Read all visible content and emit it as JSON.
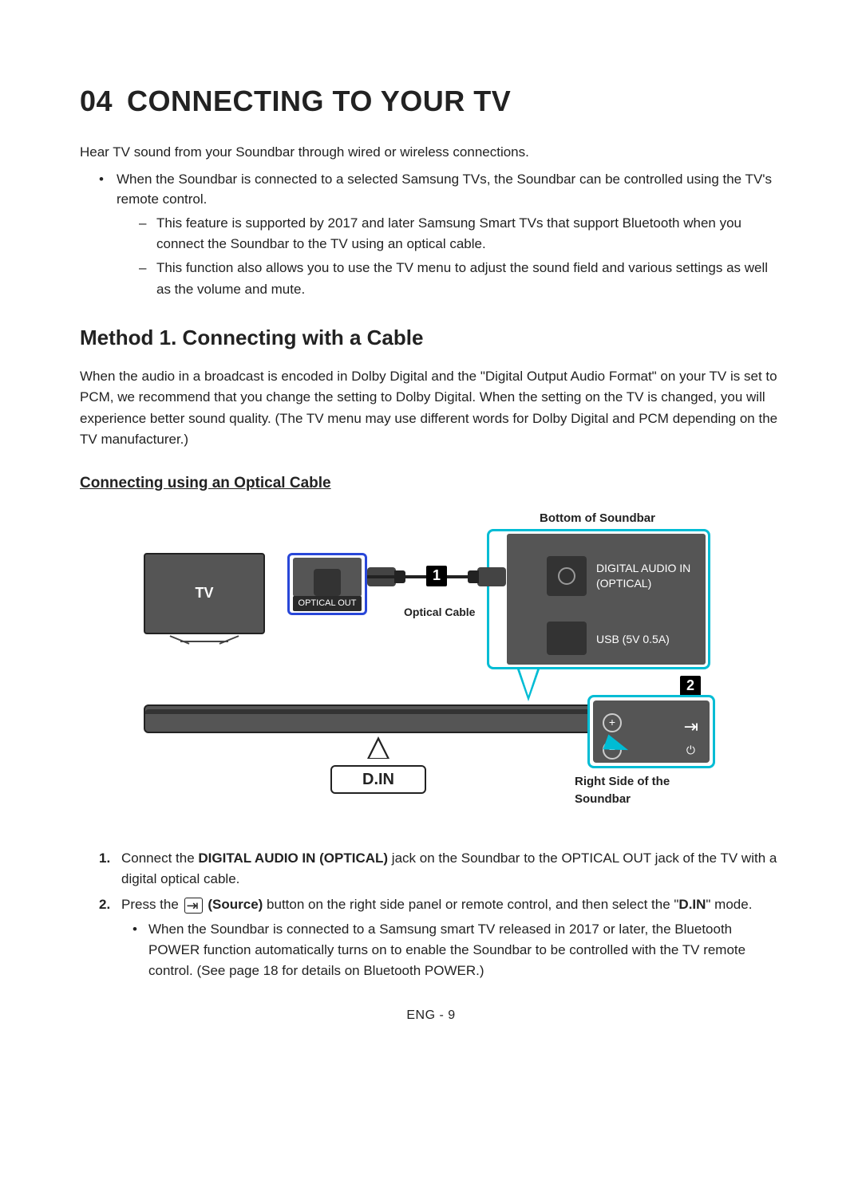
{
  "chapter": {
    "number": "04",
    "title": "CONNECTING TO YOUR TV"
  },
  "intro": "Hear TV sound from your Soundbar through wired or wireless connections.",
  "bullets": {
    "b1": "When the Soundbar is connected to a selected Samsung TVs, the Soundbar can be controlled using the TV's remote control.",
    "d1": "This feature is supported by 2017 and later Samsung Smart TVs that support Bluetooth when you connect the Soundbar to the TV using an optical cable.",
    "d2": "This function also allows you to use the TV menu to adjust the sound field and various settings as well as the volume and mute."
  },
  "method": {
    "heading": "Method 1. Connecting with a Cable",
    "desc": "When the audio in a broadcast is encoded in Dolby Digital and the \"Digital Output Audio Format\" on your TV is set to PCM, we recommend that you change the setting to Dolby Digital. When the setting on the TV is changed, you will experience better sound quality. (The TV menu may use different words for Dolby Digital and PCM depending on the TV manufacturer.)"
  },
  "subsection": {
    "heading": "Connecting using an Optical Cable"
  },
  "diagram": {
    "bottom_label": "Bottom of Soundbar",
    "tv": "TV",
    "optical_out": "OPTICAL OUT",
    "optical_cable": "Optical Cable",
    "digital_audio_in_l1": "DIGITAL AUDIO IN",
    "digital_audio_in_l2": "(OPTICAL)",
    "usb": "USB (5V 0.5A)",
    "step1": "1",
    "step2": "2",
    "din": "D.IN",
    "right_side": "Right Side of the Soundbar",
    "plus": "+",
    "minus": "−",
    "src": "⇥",
    "pwr": "⏻"
  },
  "steps": {
    "s1_pre": "Connect the ",
    "s1_bold": "DIGITAL AUDIO IN (OPTICAL)",
    "s1_post": " jack on the Soundbar to the OPTICAL OUT jack of the TV with a digital optical cable.",
    "s2_pre": "Press the ",
    "s2_icon": "⇥",
    "s2_bold": " (Source)",
    "s2_mid": " button on the right side panel or remote control, and then select the \"",
    "s2_bold2": "D.IN",
    "s2_post": "\" mode.",
    "s2_sub": "When the Soundbar is connected to a Samsung smart TV released in 2017 or later, the Bluetooth POWER function automatically turns on to enable the Soundbar to be controlled with the TV remote control. (See page 18 for details on Bluetooth POWER.)"
  },
  "footer": "ENG - 9"
}
